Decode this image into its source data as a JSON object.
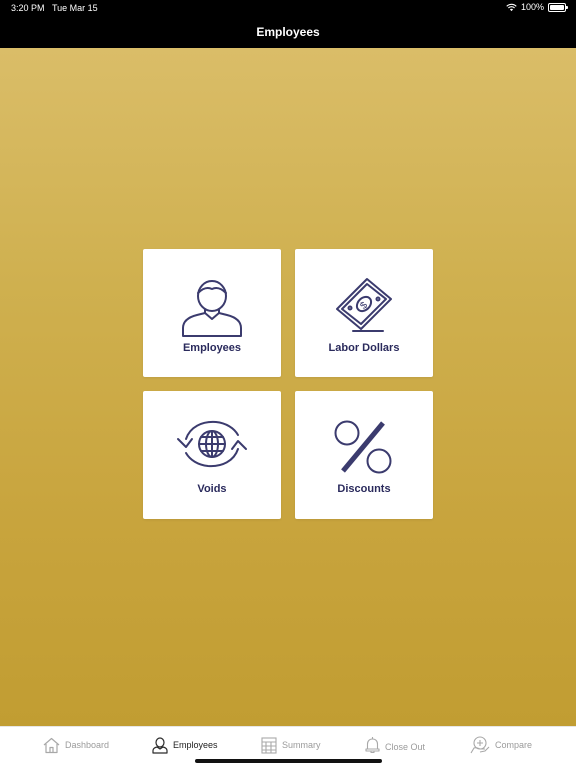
{
  "status_bar": {
    "time": "3:20 PM",
    "date": "Tue Mar 15",
    "battery": "100%"
  },
  "header": {
    "title": "Employees"
  },
  "tiles": [
    {
      "label": "Employees",
      "icon": "person-icon"
    },
    {
      "label": "Labor Dollars",
      "icon": "money-bill-icon"
    },
    {
      "label": "Voids",
      "icon": "globe-refresh-icon"
    },
    {
      "label": "Discounts",
      "icon": "percent-icon"
    }
  ],
  "tab_bar": {
    "items": [
      {
        "label": "Dashboard",
        "icon": "home-icon",
        "active": false
      },
      {
        "label": "Employees",
        "icon": "person-icon",
        "active": true
      },
      {
        "label": "Summary",
        "icon": "report-icon",
        "active": false
      },
      {
        "label": "Close Out",
        "icon": "bell-icon",
        "active": false
      },
      {
        "label": "Compare",
        "icon": "compare-icon",
        "active": false
      }
    ]
  },
  "colors": {
    "background": "#c6a43a",
    "nav": "#000000",
    "tile_label": "#2a2a5c",
    "icon_stroke": "#3b3b6e"
  }
}
